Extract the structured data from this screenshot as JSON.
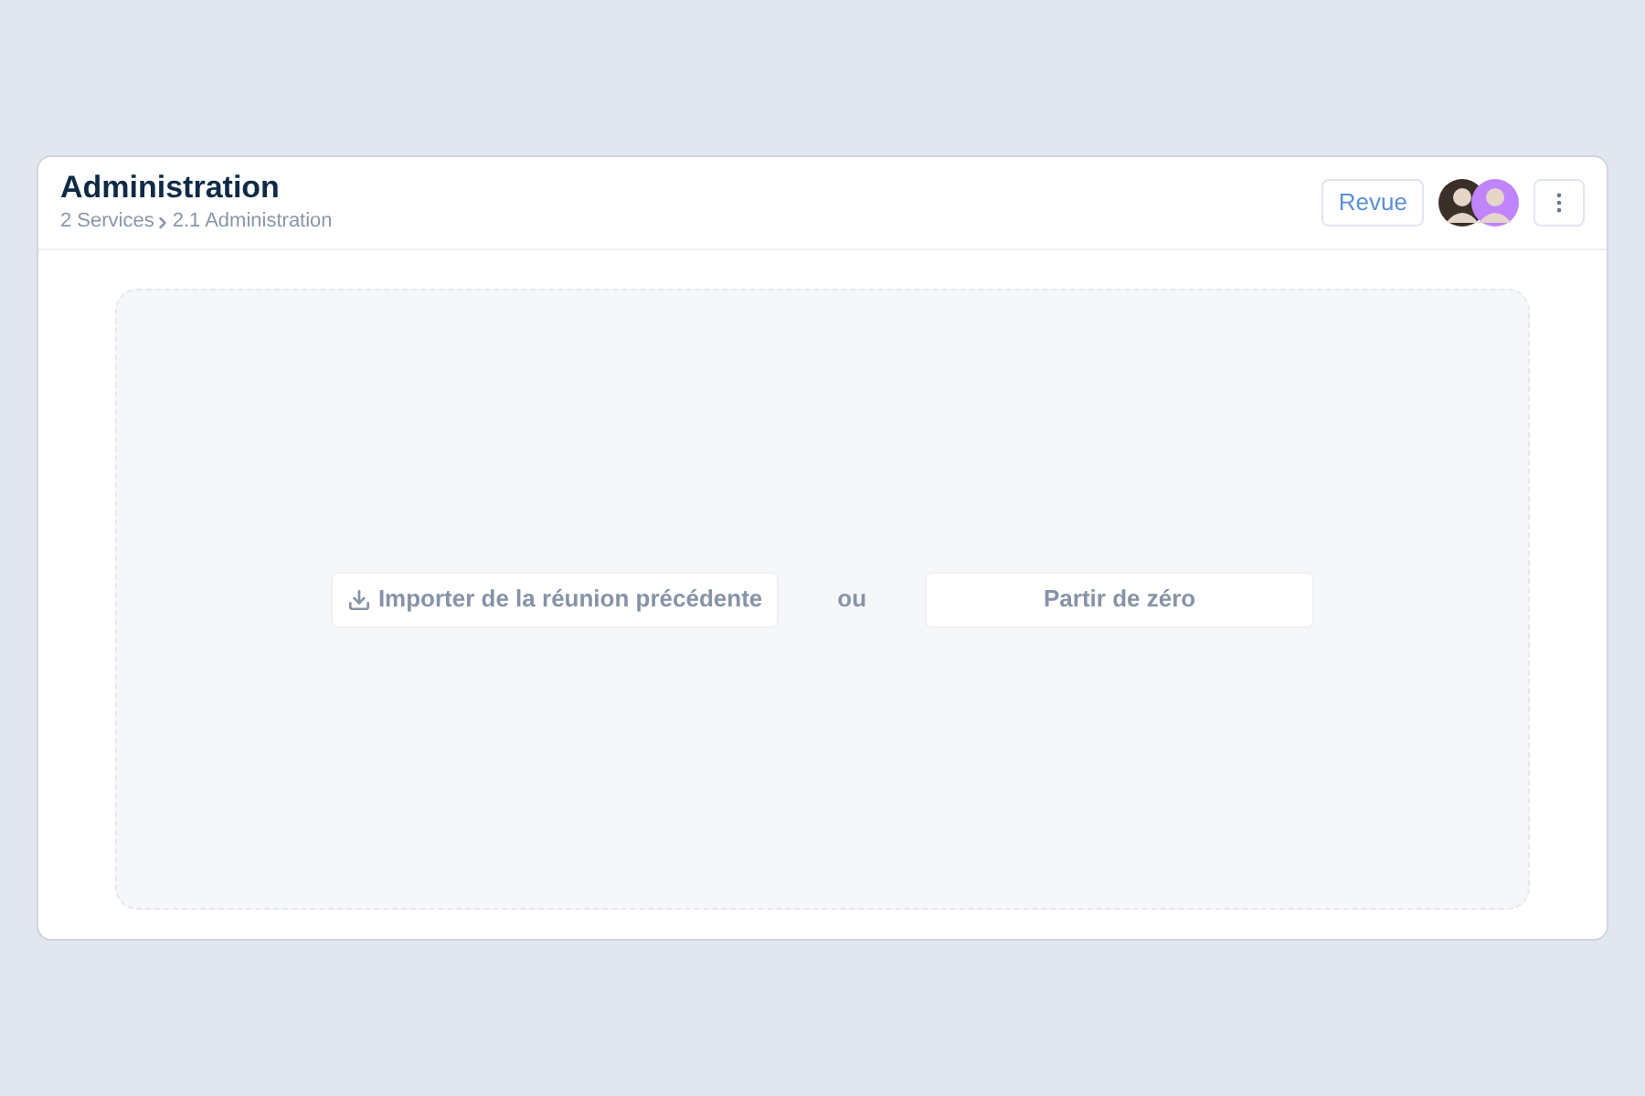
{
  "header": {
    "title": "Administration",
    "breadcrumb": [
      "2 Services",
      "2.1 Administration"
    ],
    "review_button": "Revue",
    "avatars": [
      {
        "color": "#3b2f2a"
      },
      {
        "color": "#c084fc"
      }
    ]
  },
  "actions": {
    "import_button": "Importer de la réunion précédente",
    "separator": "ou",
    "scratch_button": "Partir de zéro"
  }
}
